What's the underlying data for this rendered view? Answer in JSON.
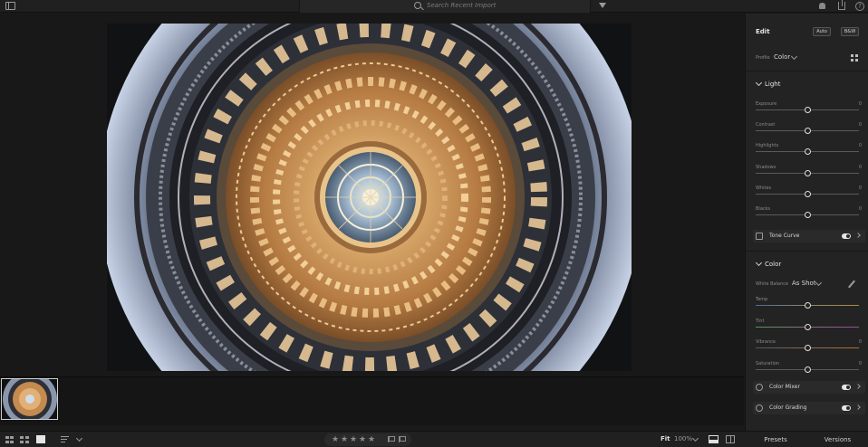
{
  "search": {
    "placeholder": "Search Recent Import"
  },
  "panel": {
    "title": "Edit",
    "auto_label": "Auto",
    "bw_label": "B&W",
    "profile_label": "Profile",
    "profile_value": "Color",
    "light": {
      "title": "Light",
      "sliders": [
        {
          "label": "Exposure",
          "value": "0",
          "position": 0.5
        },
        {
          "label": "Contrast",
          "value": "0",
          "position": 0.5
        },
        {
          "label": "Highlights",
          "value": "0",
          "position": 0.5
        },
        {
          "label": "Shadows",
          "value": "0",
          "position": 0.5
        },
        {
          "label": "Whites",
          "value": "0",
          "position": 0.5
        },
        {
          "label": "Blacks",
          "value": "0",
          "position": 0.5
        }
      ],
      "tone_curve_label": "Tone Curve"
    },
    "color": {
      "title": "Color",
      "white_balance_label": "White Balance",
      "white_balance_value": "As Shot",
      "sliders": [
        {
          "label": "Temp",
          "value": "",
          "position": 0.5
        },
        {
          "label": "Tint",
          "value": "",
          "position": 0.5
        },
        {
          "label": "Vibrance",
          "value": "0",
          "position": 0.5
        },
        {
          "label": "Saturation",
          "value": "0",
          "position": 0.5
        }
      ],
      "color_mixer_label": "Color Mixer",
      "color_grading_label": "Color Grading"
    }
  },
  "bottom": {
    "fit_label": "Fit",
    "zoom_value": "100%",
    "presets_label": "Presets",
    "versions_label": "Versions",
    "rating": 0
  }
}
